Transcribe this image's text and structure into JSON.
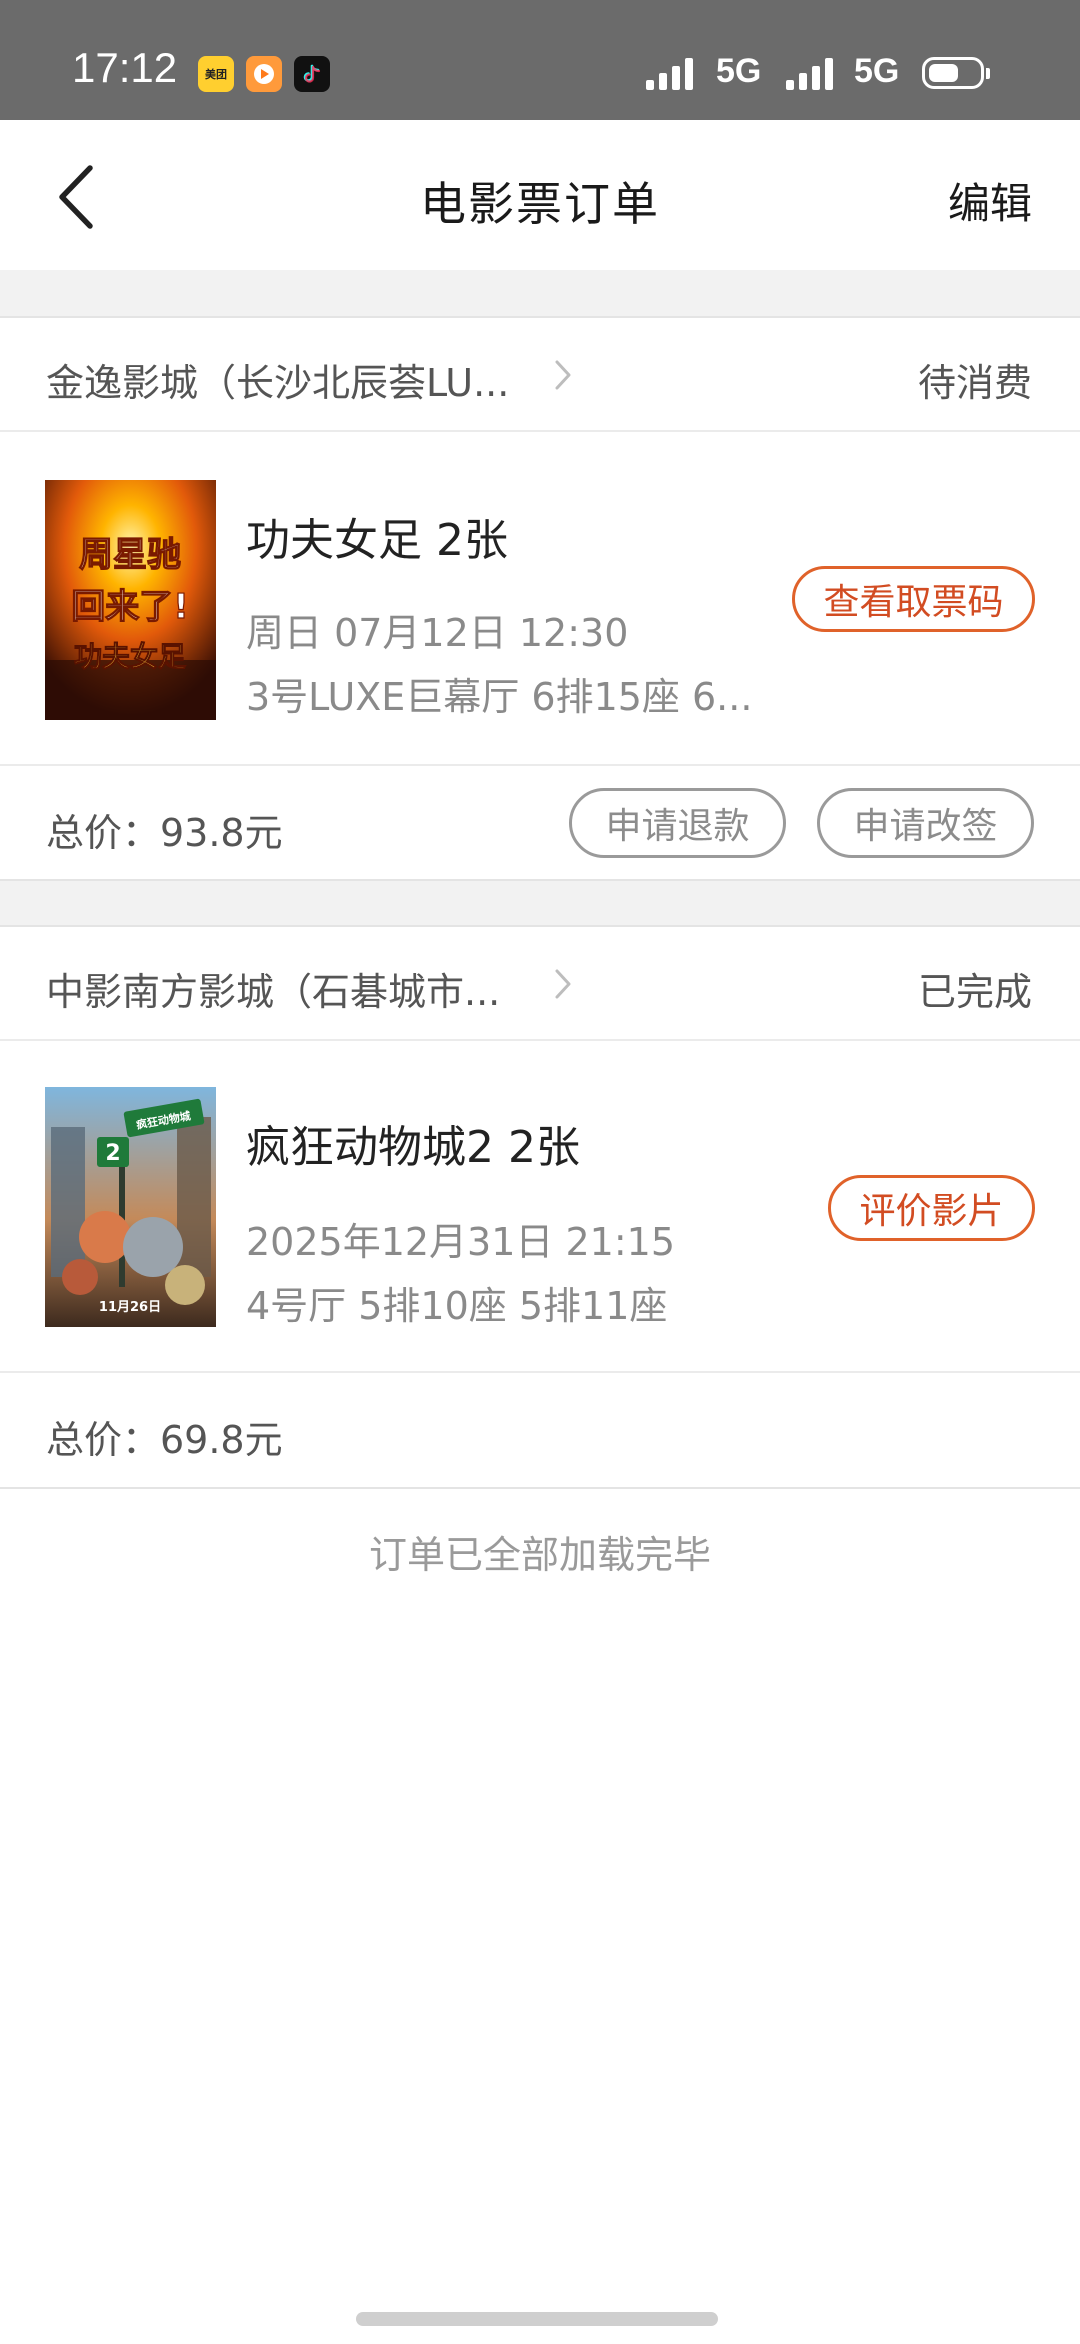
{
  "status_bar": {
    "time": "17:12",
    "apps": [
      "meituan-icon",
      "video-app-icon",
      "tiktok-icon"
    ],
    "app_meituan_label": "美团",
    "network1": "5G",
    "network2": "5G",
    "battery_level": 0.6
  },
  "nav": {
    "title": "电影票订单",
    "edit_label": "编辑"
  },
  "orders": [
    {
      "cinema": "金逸影城（长沙北辰荟LU...",
      "status": "待消费",
      "movie": "功夫女足 2张",
      "time": "周日 07月12日 12:30",
      "seats": "3号LUXE巨幕厅 6排15座 6...",
      "action": "查看取票码",
      "total": "总价：93.8元",
      "buttons": [
        "申请退款",
        "申请改签"
      ],
      "poster_text": [
        "周星驰",
        "回来了!",
        "功夫女足"
      ]
    },
    {
      "cinema": "中影南方影城（石碁城市...",
      "status": "已完成",
      "movie": "疯狂动物城2 2张",
      "time": "2025年12月31日 21:15",
      "seats": "4号厅 5排10座 5排11座",
      "action": "评价影片",
      "total": "总价：69.8元",
      "poster_text": [
        "疯狂动物城",
        "2",
        "11月26日"
      ]
    }
  ],
  "footer_text": "订单已全部加载完毕",
  "colors": {
    "accent": "#e0622a",
    "status_bar": "#6b6b6b",
    "divider": "#f2f2f2"
  }
}
